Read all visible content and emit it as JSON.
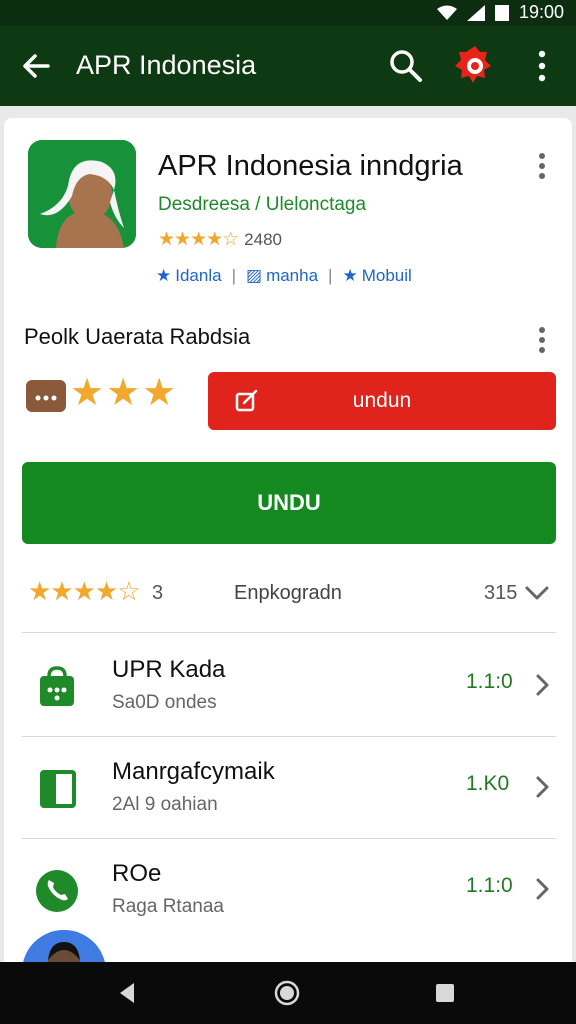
{
  "status_bar": {
    "time": "19:00"
  },
  "app_bar": {
    "title": "APR Indonesia"
  },
  "app": {
    "title": "APR Indonesia inndgria",
    "developer": "Desdreesa / Ulelonctaga",
    "rating_stars": 4.5,
    "rating_count": "2480",
    "tags": [
      "Idanla",
      "manha",
      "Mobuil"
    ]
  },
  "section": {
    "title": "Peolk Uaerata Rabdsia",
    "stars": 3,
    "red_button_label": "undun"
  },
  "green_button_label": "UNDU",
  "summary": {
    "stars": 4,
    "count": "3",
    "label": "Enpkogradn",
    "number": "315"
  },
  "list": [
    {
      "title": "UPR Kada",
      "subtitle": "Sa0D ondes",
      "version": "1.1:0",
      "icon": "shopping-bag-icon"
    },
    {
      "title": "Manrgafcymaik",
      "subtitle": "2Al 9 oahian",
      "version": "1.K0",
      "icon": "book-icon"
    },
    {
      "title": "ROe",
      "subtitle": "Raga Rtanaa",
      "version": "1.1:0",
      "icon": "phone-icon"
    }
  ],
  "colors": {
    "appbar": "#0d3a12",
    "green_button": "#14891f",
    "red_button": "#e0231b",
    "star": "#f2a82c",
    "link_blue": "#1f66c8"
  }
}
